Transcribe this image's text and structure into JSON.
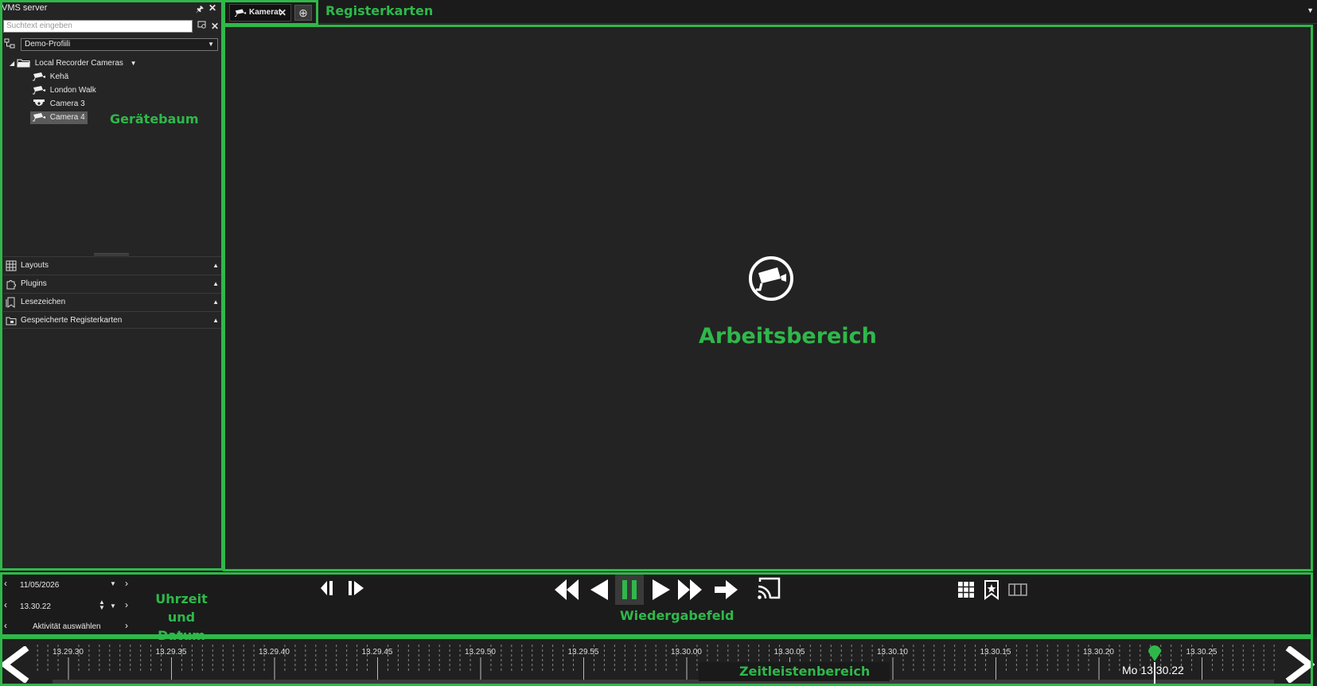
{
  "left_panel": {
    "title": "VMS server",
    "search_placeholder": "Suchtext eingeben",
    "profile": "Demo-Profiili",
    "tree": {
      "root": "Local Recorder Cameras",
      "items": [
        "Kehä",
        "London Walk",
        "Camera 3",
        "Camera 4"
      ],
      "selected": "Camera 4"
    },
    "sections": [
      "Layouts",
      "Plugins",
      "Lesezeichen",
      "Gespeicherte Registerkarten"
    ]
  },
  "tabs": {
    "active_label": "Kamerat",
    "close_glyph": "✕",
    "add_glyph": "⊕"
  },
  "annotations": {
    "tree": "Gerätebaum",
    "tabs": "Registerkarten",
    "workspace": "Arbeitsbereich",
    "datetime_1": "Uhrzeit und",
    "datetime_2": "Datum",
    "playback": "Wiedergabefeld",
    "timeline": "Zeitleistenbereich"
  },
  "datetime": {
    "date": "11/05/2026",
    "time": "13.30.22",
    "activity": "Aktivität auswählen"
  },
  "playback": {
    "buttons": [
      "skip-back",
      "prev-frame",
      "pause",
      "play",
      "fast-forward",
      "go-live",
      "cast"
    ],
    "active_button": "pause",
    "accent_color": "#2fb84a"
  },
  "timeline": {
    "ticks": [
      "13.29.30",
      "13.29.35",
      "13.29.40",
      "13.29.45",
      "13.29.50",
      "13.29.55",
      "13.30.00",
      "13.30.05",
      "13.30.10",
      "13.30.15",
      "13.30.20",
      "13.30.25"
    ],
    "current": "Mo 13.30.22"
  },
  "colors": {
    "accent": "#2fb84a",
    "background": "#232323"
  }
}
